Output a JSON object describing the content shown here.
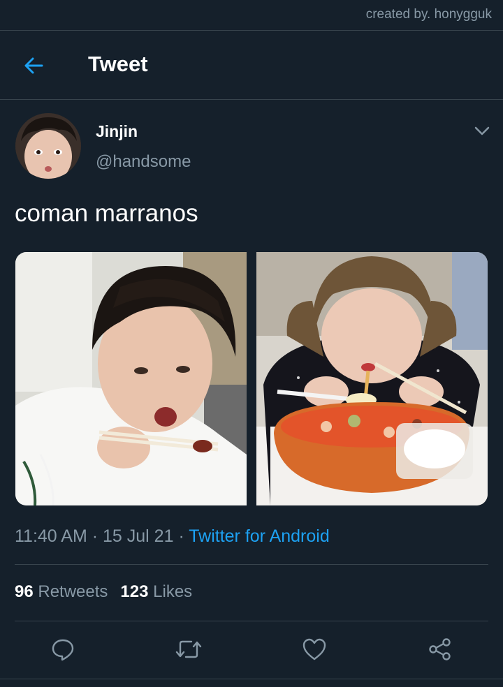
{
  "credit": "created by. honygguk",
  "header": {
    "title": "Tweet",
    "back_icon": "arrow-left-icon"
  },
  "tweet": {
    "display_name": "Jinjin",
    "handle": "@handsome",
    "text": "coman marranos",
    "time": "11:40 AM",
    "dot": "·",
    "date": "15 Jul 21",
    "source": "Twitter for Android",
    "retweets_count": "96",
    "retweets_label": "Retweets",
    "likes_count": "123",
    "likes_label": "Likes"
  },
  "actions": [
    "reply-icon",
    "retweet-icon",
    "like-icon",
    "share-icon"
  ],
  "colors": {
    "background": "#15202b",
    "accent": "#1da1f2",
    "muted": "#8899a6",
    "divider": "#38444d"
  }
}
